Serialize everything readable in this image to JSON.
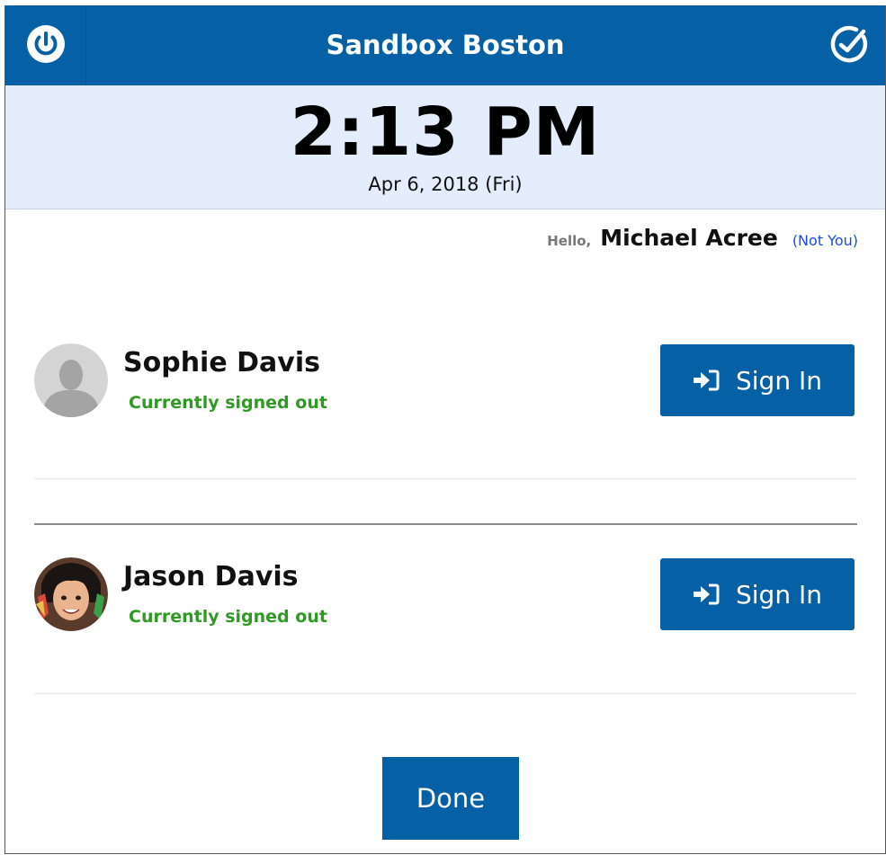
{
  "header": {
    "title": "Sandbox Boston",
    "left_icon": "power-icon",
    "right_icon": "check-clock-icon"
  },
  "clock": {
    "time": "2:13 PM",
    "date": "Apr 6, 2018 (Fri)"
  },
  "greeting": {
    "hello": "Hello,",
    "user": "Michael Acree",
    "not_you": "(Not You)"
  },
  "people": [
    {
      "name": "Sophie Davis",
      "status": "Currently signed out",
      "avatar": "default-avatar",
      "action": "Sign In"
    },
    {
      "name": "Jason Davis",
      "status": "Currently signed out",
      "avatar": "child-photo-avatar",
      "action": "Sign In"
    }
  ],
  "footer": {
    "done_label": "Done"
  },
  "colors": {
    "primary": "#0560a5",
    "clock_band": "#e3edfb",
    "status_green": "#2f9a23",
    "link_blue": "#1a4fe0"
  }
}
